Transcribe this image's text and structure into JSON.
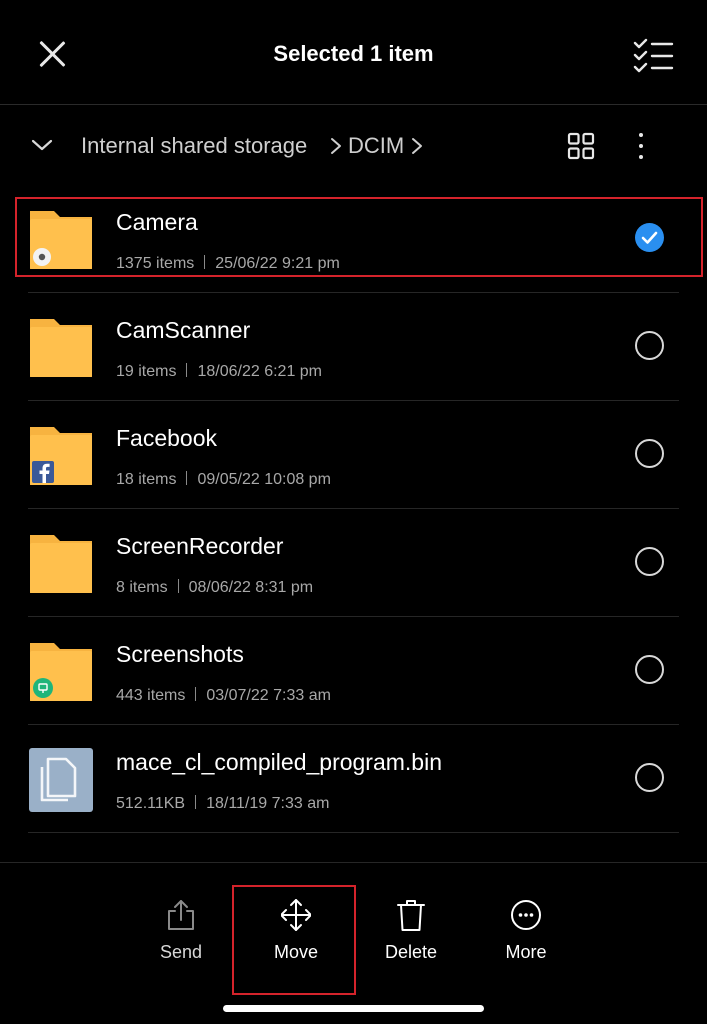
{
  "header": {
    "title": "Selected 1 item",
    "close_icon": "close-icon",
    "select_all_icon": "checklist-icon"
  },
  "breadcrumb": {
    "root": "Internal shared storage",
    "current": "DCIM",
    "separator_icon": "chevron-right-icon"
  },
  "files": [
    {
      "name": "Camera",
      "count": "1375 items",
      "date": "25/06/22 9:21 pm",
      "type": "folder",
      "badge": "camera",
      "selected": true
    },
    {
      "name": "CamScanner",
      "count": "19 items",
      "date": "18/06/22 6:21 pm",
      "type": "folder",
      "badge": "",
      "selected": false
    },
    {
      "name": "Facebook",
      "count": "18 items",
      "date": "09/05/22 10:08 pm",
      "type": "folder",
      "badge": "facebook",
      "selected": false
    },
    {
      "name": "ScreenRecorder",
      "count": "8 items",
      "date": "08/06/22 8:31 pm",
      "type": "folder",
      "badge": "",
      "selected": false
    },
    {
      "name": "Screenshots",
      "count": "443 items",
      "date": "03/07/22 7:33 am",
      "type": "folder",
      "badge": "screenshot",
      "selected": false
    },
    {
      "name": "mace_cl_compiled_program.bin",
      "count": "512.11KB",
      "date": "18/11/19 7:33 am",
      "type": "file",
      "badge": "",
      "selected": false
    }
  ],
  "toolbar": {
    "send": "Send",
    "move": "Move",
    "delete": "Delete",
    "more": "More"
  },
  "colors": {
    "background": "#000000",
    "folder": "#ffc04d",
    "accent": "#2a8ff0",
    "highlight": "#d4232b"
  }
}
